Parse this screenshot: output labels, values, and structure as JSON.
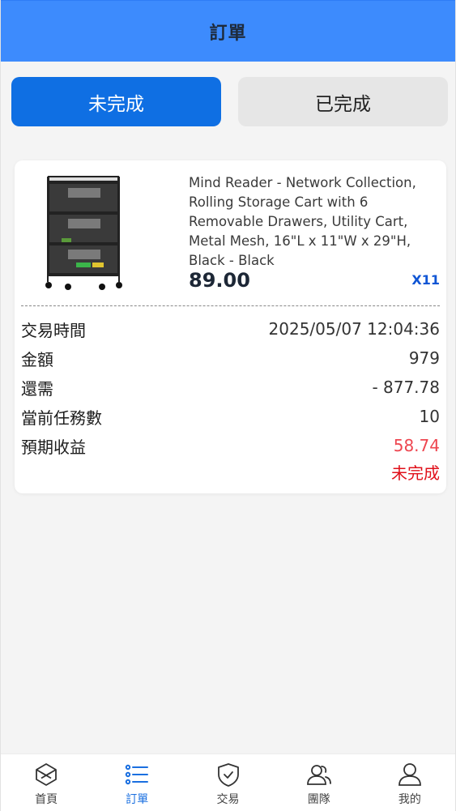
{
  "header": {
    "title": "訂單"
  },
  "tabs": [
    {
      "label": "未完成",
      "active": true
    },
    {
      "label": "已完成",
      "active": false
    }
  ],
  "order": {
    "product_name": "Mind Reader - Network Collection, Rolling Storage Cart with 6 Removable Drawers, Utility Cart, Metal Mesh, 16\"L x 11\"W x 29\"H, Black - Black",
    "price": "89.00",
    "quantity": "X11",
    "details": [
      {
        "label": "交易時間",
        "value": "2025/05/07 12:04:36"
      },
      {
        "label": "金額",
        "value": "979"
      },
      {
        "label": "還需",
        "value": "- 877.78"
      },
      {
        "label": "當前任務數",
        "value": "10"
      },
      {
        "label": "預期收益",
        "value": "58.74"
      }
    ],
    "status": "未完成"
  },
  "nav": [
    {
      "label": "首頁",
      "icon": "home-cube-icon"
    },
    {
      "label": "訂單",
      "icon": "list-icon",
      "active": true
    },
    {
      "label": "交易",
      "icon": "shield-check-icon"
    },
    {
      "label": "團隊",
      "icon": "team-icon"
    },
    {
      "label": "我的",
      "icon": "user-icon"
    }
  ],
  "colors": {
    "header_bg": "#3d8bfd",
    "active_tab": "#0f6fe3",
    "qty": "#0f55d4",
    "income": "#ee4650",
    "status": "#e0101a",
    "nav_active": "#1a6fe0"
  }
}
